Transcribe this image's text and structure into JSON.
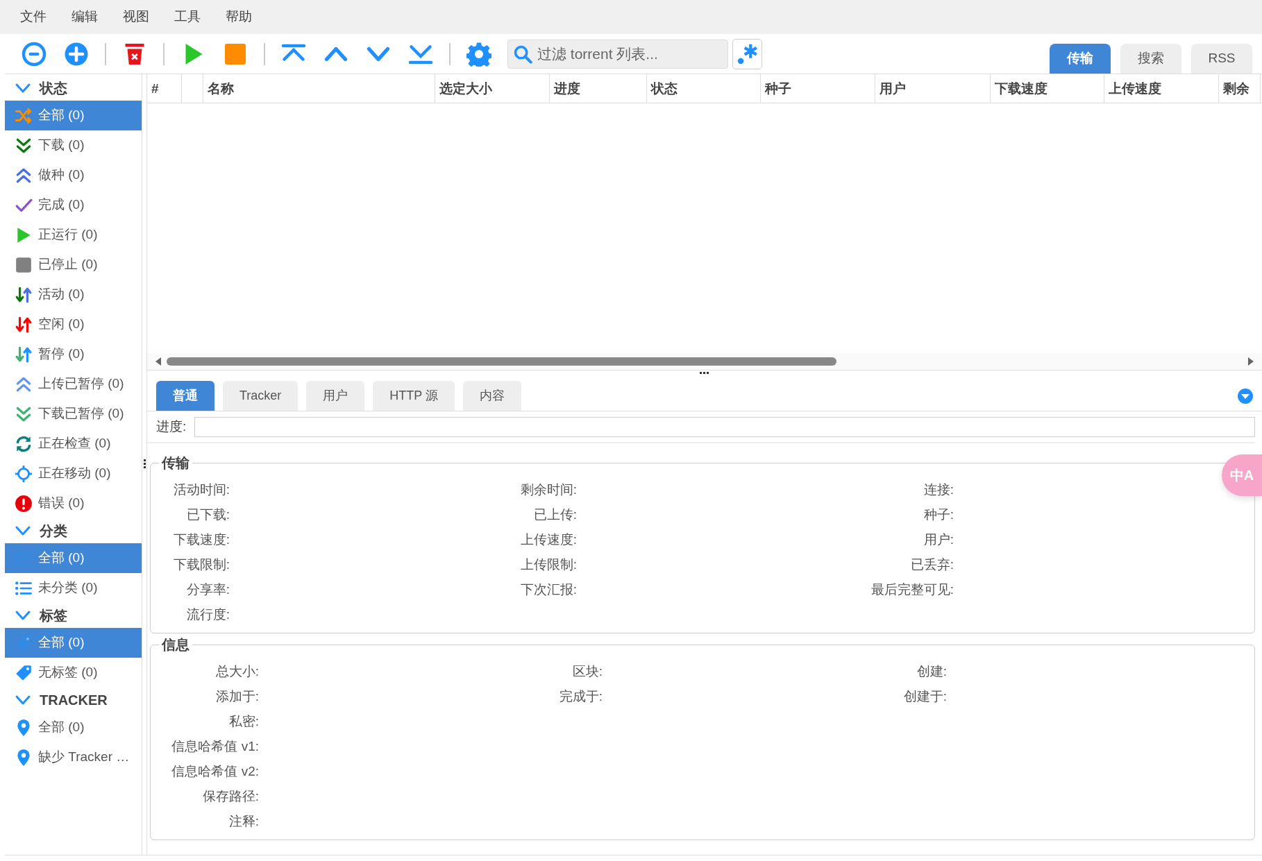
{
  "menu": [
    "文件",
    "编辑",
    "视图",
    "工具",
    "帮助"
  ],
  "toolbar": {
    "search_placeholder": "过滤 torrent 列表..."
  },
  "view_tabs": [
    {
      "label": "传输",
      "selected": true
    },
    {
      "label": "搜索",
      "selected": false
    },
    {
      "label": "RSS",
      "selected": false
    }
  ],
  "sidebar": [
    {
      "title": "状态",
      "expanded": true,
      "items": [
        {
          "label": "全部 (0)",
          "selected": true
        },
        {
          "label": "下载 (0)",
          "selected": false
        },
        {
          "label": "做种 (0)",
          "selected": false
        },
        {
          "label": "完成 (0)",
          "selected": false
        },
        {
          "label": "正运行 (0)",
          "selected": false
        },
        {
          "label": "已停止 (0)",
          "selected": false
        },
        {
          "label": "活动 (0)",
          "selected": false
        },
        {
          "label": "空闲 (0)",
          "selected": false
        },
        {
          "label": "暂停 (0)",
          "selected": false
        },
        {
          "label": "上传已暂停 (0)",
          "selected": false
        },
        {
          "label": "下载已暂停 (0)",
          "selected": false
        },
        {
          "label": "正在检查 (0)",
          "selected": false
        },
        {
          "label": "正在移动 (0)",
          "selected": false
        },
        {
          "label": "错误 (0)",
          "selected": false
        }
      ]
    },
    {
      "title": "分类",
      "expanded": true,
      "items": [
        {
          "label": "全部 (0)",
          "selected": true
        },
        {
          "label": "未分类 (0)",
          "selected": false
        }
      ]
    },
    {
      "title": "标签",
      "expanded": true,
      "items": [
        {
          "label": "全部 (0)",
          "selected": true
        },
        {
          "label": "无标签 (0)",
          "selected": false
        }
      ]
    },
    {
      "title": "TRACKER",
      "expanded": true,
      "items": [
        {
          "label": "全部 (0)",
          "selected": false
        },
        {
          "label": "缺少 Tracker …",
          "selected": false
        }
      ]
    }
  ],
  "table": {
    "columns": [
      "#",
      "名称",
      "选定大小",
      "进度",
      "状态",
      "种子",
      "用户",
      "下载速度",
      "上传速度",
      "剩余"
    ]
  },
  "details": {
    "tabs": [
      {
        "label": "普通",
        "selected": true
      },
      {
        "label": "Tracker",
        "selected": false
      },
      {
        "label": "用户",
        "selected": false
      },
      {
        "label": "HTTP 源",
        "selected": false
      },
      {
        "label": "内容",
        "selected": false
      }
    ],
    "progress": {
      "label": "进度:",
      "level": 0
    },
    "sections": [
      {
        "title": "传输",
        "columns": [
          [
            "活动时间:",
            "已下载:",
            "下载速度:",
            "下载限制:",
            "分享率:",
            "流行度:"
          ],
          [
            "剩余时间:",
            "已上传:",
            "上传速度:",
            "上传限制:",
            "下次汇报:"
          ],
          [
            "连接:",
            "种子:",
            "用户:",
            "已丢弃:",
            "最后完整可见:"
          ]
        ]
      },
      {
        "title": "信息",
        "columns": [
          [
            "总大小:",
            "添加于:",
            "私密:",
            "信息哈希值 v1:",
            "信息哈希值 v2:",
            "保存路径:",
            "注释:"
          ],
          [
            "区块:",
            "完成于:"
          ],
          [
            "创建:",
            "创建于:"
          ]
        ]
      }
    ]
  },
  "translate_badge": "中A"
}
